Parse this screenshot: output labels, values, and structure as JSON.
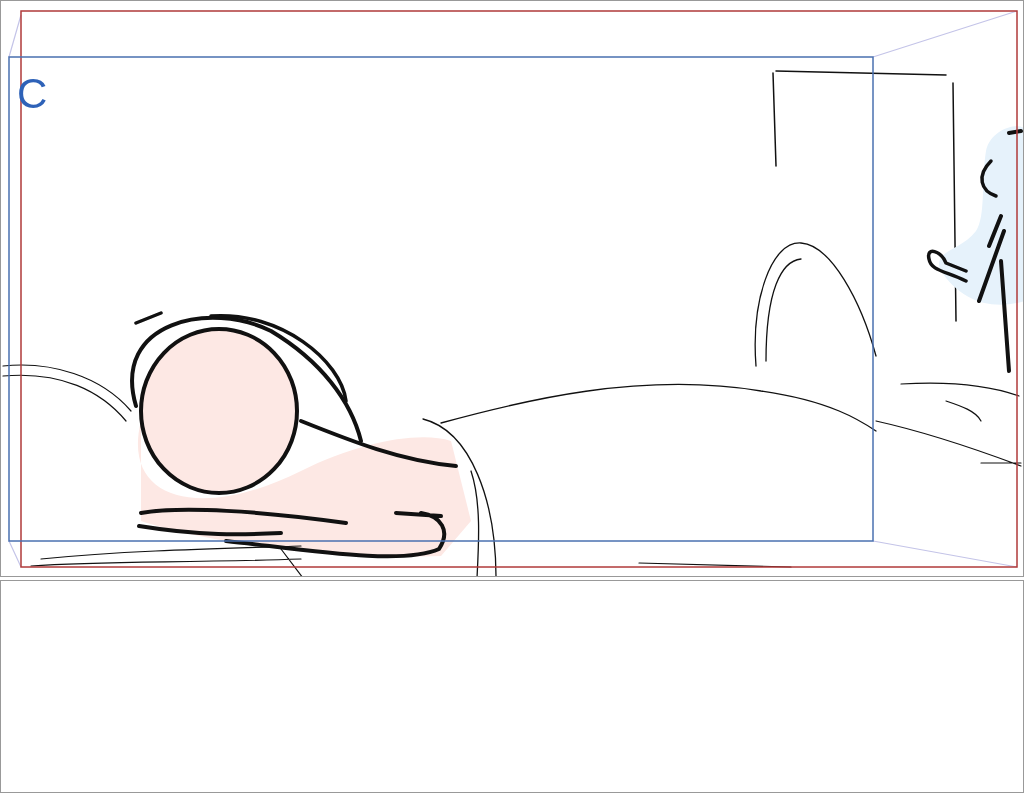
{
  "canvas": {
    "frame_label": "C"
  }
}
